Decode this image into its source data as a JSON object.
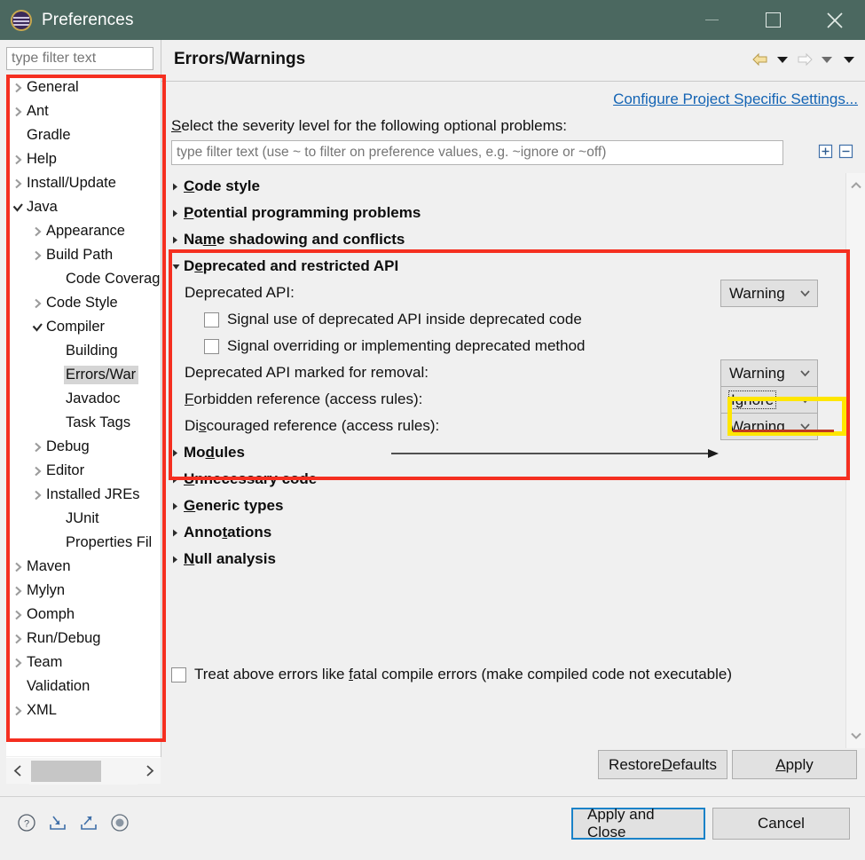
{
  "window": {
    "title": "Preferences",
    "icon": "eclipse-logo-icon",
    "minimize_label": "",
    "maximize_label": "",
    "close_label": ""
  },
  "sidebar": {
    "filter_placeholder": "type filter text",
    "filter_value": "",
    "items": [
      {
        "label": "General",
        "level": 0,
        "twisty": "collapsed"
      },
      {
        "label": "Ant",
        "level": 0,
        "twisty": "collapsed"
      },
      {
        "label": "Gradle",
        "level": 0,
        "twisty": "none"
      },
      {
        "label": "Help",
        "level": 0,
        "twisty": "collapsed"
      },
      {
        "label": "Install/Update",
        "level": 0,
        "twisty": "collapsed"
      },
      {
        "label": "Java",
        "level": 0,
        "twisty": "expanded"
      },
      {
        "label": "Appearance",
        "level": 1,
        "twisty": "collapsed"
      },
      {
        "label": "Build Path",
        "level": 1,
        "twisty": "collapsed"
      },
      {
        "label": "Code Coverag",
        "level": 2,
        "twisty": "none"
      },
      {
        "label": "Code Style",
        "level": 1,
        "twisty": "collapsed"
      },
      {
        "label": "Compiler",
        "level": 1,
        "twisty": "expanded"
      },
      {
        "label": "Building",
        "level": 2,
        "twisty": "none"
      },
      {
        "label": "Errors/War",
        "level": 2,
        "twisty": "none",
        "selected": true
      },
      {
        "label": "Javadoc",
        "level": 2,
        "twisty": "none"
      },
      {
        "label": "Task Tags",
        "level": 2,
        "twisty": "none"
      },
      {
        "label": "Debug",
        "level": 1,
        "twisty": "collapsed"
      },
      {
        "label": "Editor",
        "level": 1,
        "twisty": "collapsed"
      },
      {
        "label": "Installed JREs",
        "level": 1,
        "twisty": "collapsed"
      },
      {
        "label": "JUnit",
        "level": 2,
        "twisty": "none"
      },
      {
        "label": "Properties Fil",
        "level": 2,
        "twisty": "none"
      },
      {
        "label": "Maven",
        "level": 0,
        "twisty": "collapsed"
      },
      {
        "label": "Mylyn",
        "level": 0,
        "twisty": "collapsed"
      },
      {
        "label": "Oomph",
        "level": 0,
        "twisty": "collapsed"
      },
      {
        "label": "Run/Debug",
        "level": 0,
        "twisty": "collapsed"
      },
      {
        "label": "Team",
        "level": 0,
        "twisty": "collapsed"
      },
      {
        "label": "Validation",
        "level": 0,
        "twisty": "none"
      },
      {
        "label": "XML",
        "level": 0,
        "twisty": "collapsed"
      }
    ],
    "hscroll": {
      "left_arrow": "‹",
      "right_arrow": "›"
    }
  },
  "page": {
    "title": "Errors/Warnings",
    "configure_link": "Configure Project Specific Settings...",
    "severity_label_pre": "S",
    "severity_label_post": "elect the severity level for the following optional problems:",
    "filter_placeholder": "type filter text (use ~ to filter on preference values, e.g. ~ignore or ~off)",
    "filter_value": "",
    "nav": {
      "back": "back-arrow-icon",
      "back_menu": "back-dropdown-icon",
      "forward": "forward-arrow-icon",
      "forward_menu": "forward-dropdown-icon",
      "view_menu": "view-menu-icon"
    },
    "tree_tools": {
      "expand_all": "expand-all-icon",
      "collapse_all": "collapse-all-icon"
    },
    "categories": [
      {
        "mn": "C",
        "rest": "ode style",
        "expanded": false
      },
      {
        "mn": "P",
        "rest": "otential programming problems",
        "expanded": false
      },
      {
        "pre": "Na",
        "mn": "m",
        "rest": "e shadowing and conflicts",
        "expanded": false
      },
      {
        "pre": "D",
        "mn": "e",
        "rest": "precated and restricted API",
        "expanded": true
      },
      {
        "pre": "Mo",
        "mn": "d",
        "rest": "ules",
        "expanded": false
      },
      {
        "mn": "U",
        "rest": "nnecessary code",
        "expanded": false
      },
      {
        "mn": "G",
        "rest": "eneric types",
        "expanded": false
      },
      {
        "pre": "Anno",
        "mn": "t",
        "rest": "ations",
        "expanded": false
      },
      {
        "mn": "N",
        "rest": "ull analysis",
        "expanded": false
      }
    ],
    "deprecated_section": {
      "rows": [
        {
          "label": "Deprecated API:",
          "value": "Warning"
        },
        {
          "label": "Deprecated API marked for removal:",
          "value": "Warning"
        },
        {
          "label_pre": "F",
          "label_mn": "",
          "label": "Forbidden reference (access rules):",
          "value": "Ignore",
          "focused": true
        },
        {
          "label": "Discouraged reference (access rules):",
          "value": "Warning"
        }
      ],
      "checkboxes": [
        {
          "label": "Signal use of deprecated API inside deprecated code",
          "checked": false
        },
        {
          "label": "Signal overriding or implementing deprecated method",
          "checked": false
        }
      ]
    },
    "fatal_checkbox": {
      "pre": "Treat above errors like ",
      "mn": "f",
      "post": "atal compile errors (make compiled code not executable)",
      "checked": false
    },
    "buttons": {
      "restore_pre": "Restore ",
      "restore_mn": "D",
      "restore_post": "efaults",
      "apply_pre": "",
      "apply_mn": "A",
      "apply_post": "pply"
    }
  },
  "footer": {
    "icons": [
      "help-icon",
      "import-icon",
      "export-icon",
      "oomph-recorder-icon"
    ],
    "apply_and_close": "Apply and Close",
    "cancel": "Cancel"
  },
  "colors": {
    "titlebar": "#4b6860",
    "accent_link": "#1464b4",
    "annotation_red": "#f52f20",
    "annotation_yellow": "#ffe600",
    "focus_blue": "#1a82c8",
    "selection_gray": "#d5d5d5"
  }
}
